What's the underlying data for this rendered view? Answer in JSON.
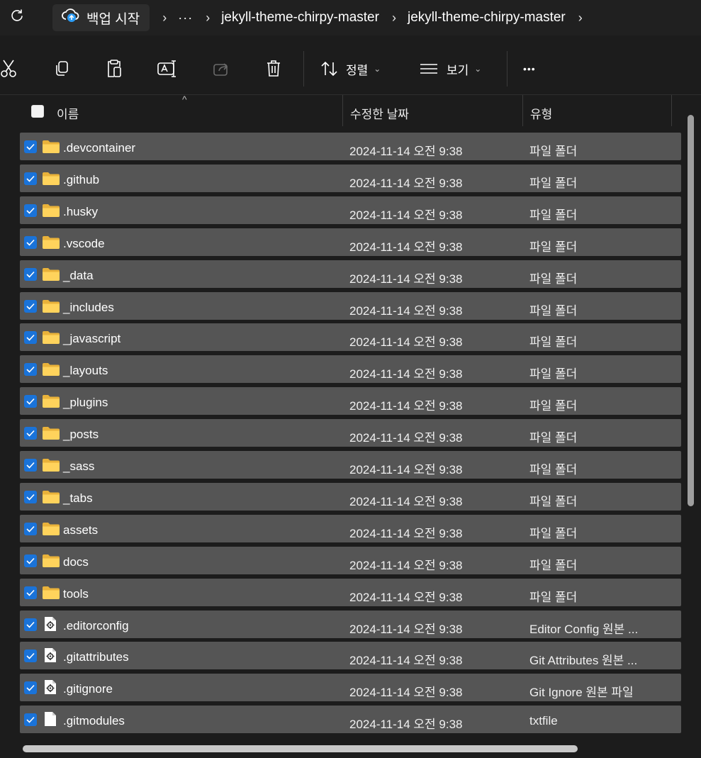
{
  "addressbar": {
    "backup_label": "백업 시작",
    "more_crumbs": "···",
    "crumbs": [
      "jekyll-theme-chirpy-master",
      "jekyll-theme-chirpy-master"
    ],
    "separator": "›",
    "refresh_icon": "refresh-icon",
    "backup_icon": "cloud-backup-icon"
  },
  "toolbar": {
    "icons": [
      "cut-icon",
      "copy-icon",
      "paste-icon",
      "rename-icon",
      "share-icon",
      "delete-icon"
    ],
    "sort_label": "정렬",
    "view_label": "보기",
    "more_label": "•••",
    "chevron": "⌄"
  },
  "columns": {
    "name": "이름",
    "modified": "수정한 날짜",
    "type": "유형",
    "sort_caret": "^"
  },
  "files": [
    {
      "name": ".devcontainer",
      "date": "2024-11-14 오전 9:38",
      "type": "파일 폴더",
      "icon": "folder-icon",
      "selected": true
    },
    {
      "name": ".github",
      "date": "2024-11-14 오전 9:38",
      "type": "파일 폴더",
      "icon": "folder-icon",
      "selected": true
    },
    {
      "name": ".husky",
      "date": "2024-11-14 오전 9:38",
      "type": "파일 폴더",
      "icon": "folder-icon",
      "selected": true
    },
    {
      "name": ".vscode",
      "date": "2024-11-14 오전 9:38",
      "type": "파일 폴더",
      "icon": "folder-icon",
      "selected": true
    },
    {
      "name": "_data",
      "date": "2024-11-14 오전 9:38",
      "type": "파일 폴더",
      "icon": "folder-icon",
      "selected": true
    },
    {
      "name": "_includes",
      "date": "2024-11-14 오전 9:38",
      "type": "파일 폴더",
      "icon": "folder-icon",
      "selected": true
    },
    {
      "name": "_javascript",
      "date": "2024-11-14 오전 9:38",
      "type": "파일 폴더",
      "icon": "folder-icon",
      "selected": true
    },
    {
      "name": "_layouts",
      "date": "2024-11-14 오전 9:38",
      "type": "파일 폴더",
      "icon": "folder-icon",
      "selected": true
    },
    {
      "name": "_plugins",
      "date": "2024-11-14 오전 9:38",
      "type": "파일 폴더",
      "icon": "folder-icon",
      "selected": true
    },
    {
      "name": "_posts",
      "date": "2024-11-14 오전 9:38",
      "type": "파일 폴더",
      "icon": "folder-icon",
      "selected": true
    },
    {
      "name": "_sass",
      "date": "2024-11-14 오전 9:38",
      "type": "파일 폴더",
      "icon": "folder-icon",
      "selected": true
    },
    {
      "name": "_tabs",
      "date": "2024-11-14 오전 9:38",
      "type": "파일 폴더",
      "icon": "folder-icon",
      "selected": true
    },
    {
      "name": "assets",
      "date": "2024-11-14 오전 9:38",
      "type": "파일 폴더",
      "icon": "folder-icon",
      "selected": true
    },
    {
      "name": "docs",
      "date": "2024-11-14 오전 9:38",
      "type": "파일 폴더",
      "icon": "folder-icon",
      "selected": true
    },
    {
      "name": "tools",
      "date": "2024-11-14 오전 9:38",
      "type": "파일 폴더",
      "icon": "folder-icon",
      "selected": true
    },
    {
      "name": ".editorconfig",
      "date": "2024-11-14 오전 9:38",
      "type": "Editor Config 원본 ...",
      "icon": "config-file-icon",
      "selected": true
    },
    {
      "name": ".gitattributes",
      "date": "2024-11-14 오전 9:38",
      "type": "Git Attributes 원본 ...",
      "icon": "config-file-icon",
      "selected": true
    },
    {
      "name": ".gitignore",
      "date": "2024-11-14 오전 9:38",
      "type": "Git Ignore 원본 파일",
      "icon": "config-file-icon",
      "selected": true
    },
    {
      "name": ".gitmodules",
      "date": "2024-11-14 오전 9:38",
      "type": "txtfile",
      "icon": "text-file-icon",
      "selected": true
    }
  ],
  "colors": {
    "background": "#1c1c1c",
    "selected_row": "#555555",
    "checkbox": "#1a73d9",
    "folder": "#ffd35c"
  }
}
